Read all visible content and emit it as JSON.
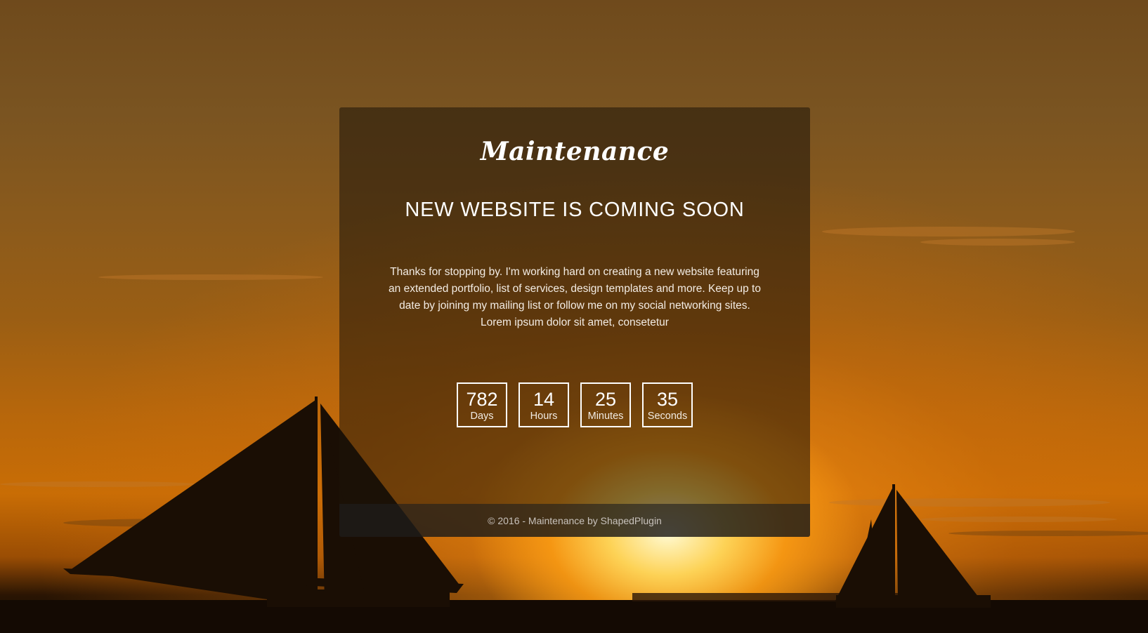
{
  "brand": {
    "logo": "Maintenance"
  },
  "headline": "NEW WEBSITE IS COMING SOON",
  "description": "Thanks for stopping by. I'm working hard on creating a new website featuring an extended portfolio, list of services, design templates and more. Keep up to date by joining my mailing list or follow me on my social networking sites. Lorem ipsum dolor sit amet, consetetur",
  "countdown": [
    {
      "value": "782",
      "label": "Days"
    },
    {
      "value": "14",
      "label": "Hours"
    },
    {
      "value": "25",
      "label": "Minutes"
    },
    {
      "value": "35",
      "label": "Seconds"
    }
  ],
  "footer": {
    "text": "© 2016 - Maintenance by ShapedPlugin"
  },
  "colors": {
    "card_overlay": "#1e140a",
    "text": "#ffffff",
    "sun": "#ffd45a"
  }
}
